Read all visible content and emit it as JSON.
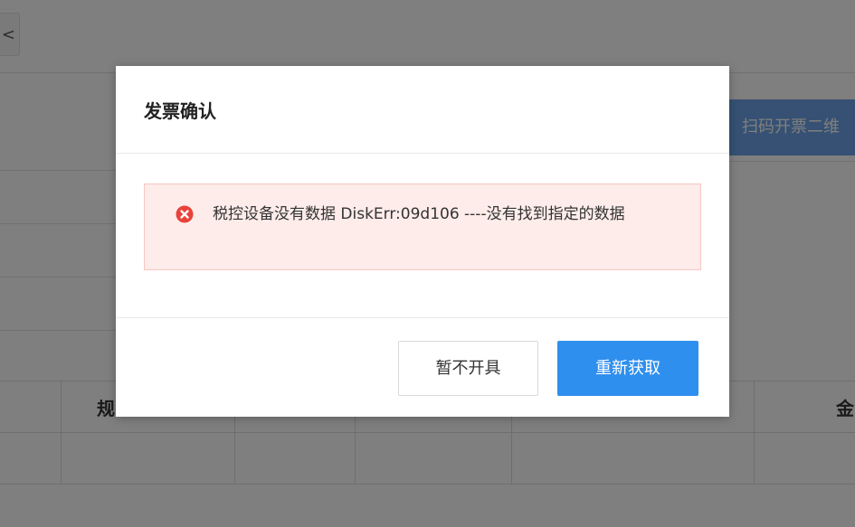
{
  "background": {
    "back_button_glyph": "<",
    "scan_button_label": "扫码开票二维",
    "table": {
      "header_left_label": "规",
      "header_right_label": "金"
    }
  },
  "dialog": {
    "title": "发票确认",
    "alert": {
      "icon": "error-circle-icon",
      "message": "税控设备没有数据 DiskErr:09d106 ----没有找到指定的数据"
    },
    "buttons": {
      "cancel_label": "暂不开具",
      "retry_label": "重新获取"
    }
  },
  "colors": {
    "mask": "rgba(0,0,0,0.5)",
    "alert_background": "#fdecea",
    "alert_border": "#f7c7c1",
    "error_icon": "#e8433b",
    "primary_button": "#2f8fee",
    "scan_button": "#6da3e6"
  }
}
